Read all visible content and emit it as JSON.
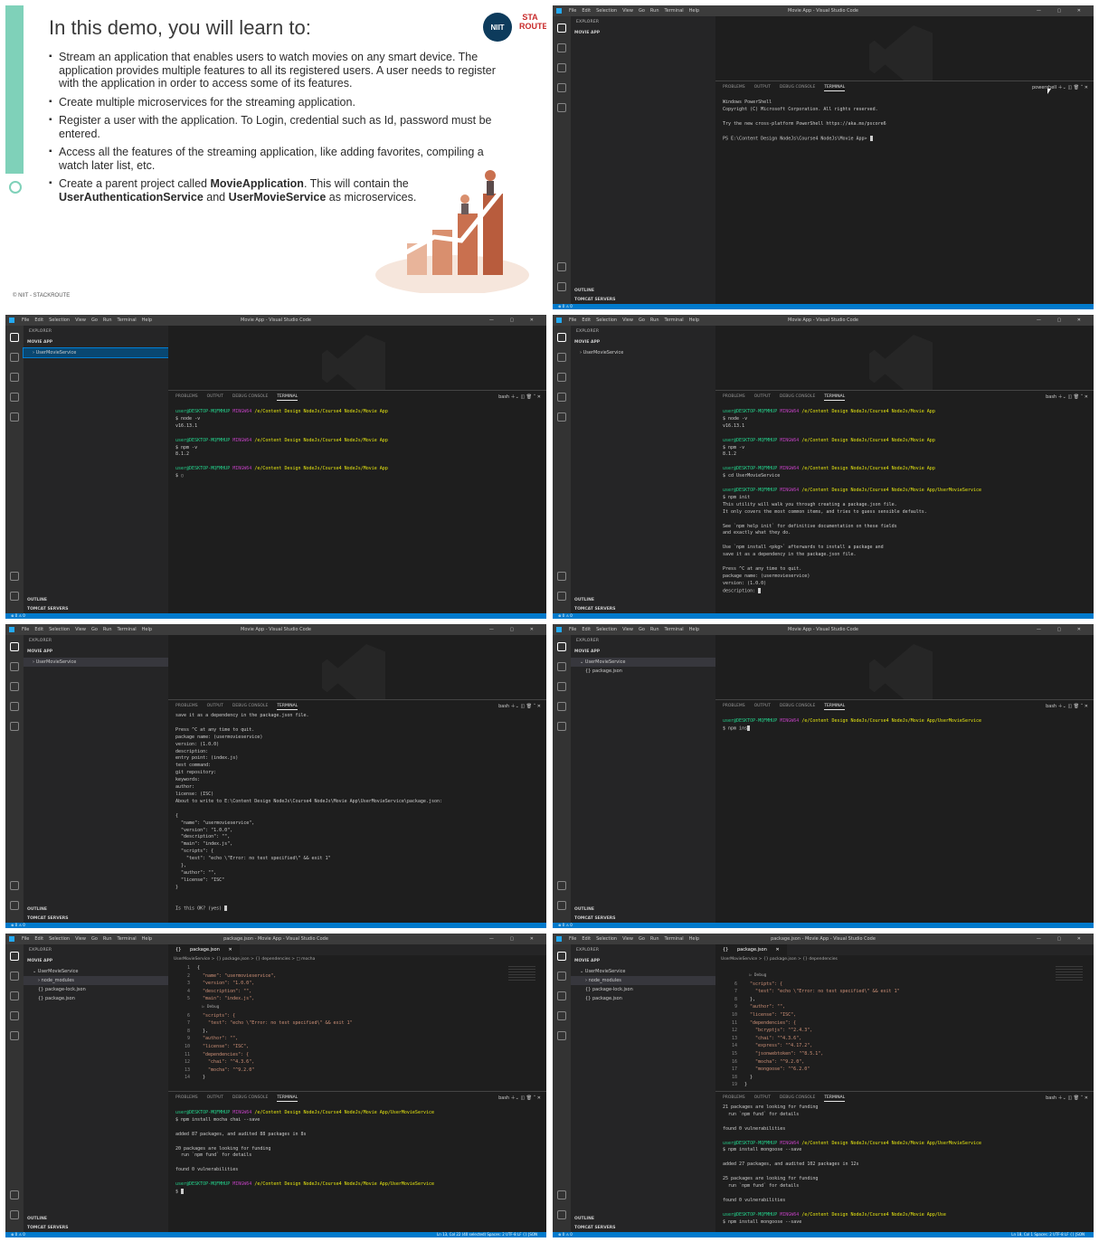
{
  "slide": {
    "title": "In this demo, you will learn to:",
    "logo_round": "NIIT",
    "logo_text": "STA ROUTE",
    "bullets": [
      "Stream an application that enables users to watch movies on any smart device. The application provides multiple features to all its registered users. A user needs to register with the application in order to access some of its features.",
      "Create multiple microservices for the streaming application.",
      "Register a user with the application. To Login, credential such as Id, password must be entered.",
      "Access all the features of the streaming application, like adding favorites, compiling a watch later list, etc."
    ],
    "bullet5_a": "Create a parent project called ",
    "bullet5_b": "MovieApplication",
    "bullet5_c": ". This will contain the ",
    "bullet5_d": "UserAuthenticationService",
    "bullet5_e": " and ",
    "bullet5_f": "UserMovieService",
    "bullet5_g": " as microservices.",
    "footer": "© NIIT - STACKROUTE"
  },
  "vscode": {
    "menu": [
      "File",
      "Edit",
      "Selection",
      "View",
      "Go",
      "Run",
      "Terminal",
      "Help"
    ],
    "title_default": "Movie App - Visual Studio Code",
    "title_pkg": "package.json - Movie App - Visual Studio Code",
    "explorer": "EXPLORER",
    "project": "MOVIE APP",
    "outline": "OUTLINE",
    "tomcat": "TOMCAT SERVERS",
    "tabs": [
      "PROBLEMS",
      "OUTPUT",
      "DEBUG CONSOLE",
      "TERMINAL"
    ],
    "shell_pwsh": "powershell",
    "shell_bash": "bash",
    "folder": "UserMovieService",
    "node_modules": "node_modules",
    "pkg_lock": "package-lock.json",
    "pkg": "package.json",
    "status_left": "⊗ 0 ⚠ 0",
    "status_right_7": "Ln 13, Col 22 (40 selected)   Spaces: 2   UTF-8   LF   {} JSON",
    "status_right_8": "Ln 18, Col 1   Spaces: 2   UTF-8   LF   {} JSON",
    "editor_tab": "package.json",
    "crumb_7": "UserMovieService > {} package.json > {} dependencies > □ mocha",
    "crumb_8": "UserMovieService > {} package.json > {} dependencies"
  },
  "terminals": {
    "t1": "Windows PowerShell\nCopyright (C) Microsoft Corporation. All rights reserved.\n\nTry the new cross-platform PowerShell https://aka.ms/pscore6\n\nPS E:\\Content Design NodeJs\\Course4 NodeJs\\Movie App> ",
    "prompt_user": "user@DESKTOP-MQFMHUP",
    "prompt_env": "MINGW64",
    "path_app": "/e/Content Design NodeJs/Course4 NodeJs/Movie App",
    "path_svc": "/e/Content Design NodeJs/Course4 NodeJs/Movie App/UserMovieService",
    "t2_a": "$ node -v\nv16.13.1\n",
    "t2_b": "$ npm -v\n8.1.2\n",
    "t2_c": "$ ",
    "t3_c": "$ cd UserMovieService\n",
    "t3_d": "$ npm init\nThis utility will walk you through creating a package.json file.\nIt only covers the most common items, and tries to guess sensible defaults.\n\nSee `npm help init` for definitive documentation on these fields\nand exactly what they do.\n\nUse `npm install <pkg>` afterwards to install a package and\nsave it as a dependency in the package.json file.\n\nPress ^C at any time to quit.\npackage name: (usermovieservice)\nversion: (1.0.0)\ndescription: ",
    "t4": "save it as a dependency in the package.json file.\n\nPress ^C at any time to quit.\npackage name: (usermovieservice)\nversion: (1.0.0)\ndescription:\nentry point: (index.js)\ntest command:\ngit repository:\nkeywords:\nauthor:\nlicense: (ISC)\nAbout to write to E:\\Content Design NodeJs\\Course4 NodeJs\\Movie App\\UserMovieService\\package.json:\n\n{\n  \"name\": \"usermovieservice\",\n  \"version\": \"1.0.0\",\n  \"description\": \"\",\n  \"main\": \"index.js\",\n  \"scripts\": {\n    \"test\": \"echo \\\"Error: no test specified\\\" && exit 1\"\n  },\n  \"author\": \"\",\n  \"license\": \"ISC\"\n}\n\n\nIs this OK? (yes) ",
    "t5": "$ npm ins",
    "t6_a": "$ npm install mocha chai --save\n\nadded 87 packages, and audited 88 packages in 8s\n\n20 packages are looking for funding\n  run `npm fund` for details\n\nfound 0 vulnerabilities\n",
    "t6_b": "$ ",
    "t7_a": "21 packages are looking for funding\n  run `npm fund` for details\n\nfound 0 vulnerabilities\n",
    "t7_b": "$ npm install mongoose --save\n\nadded 27 packages, and audited 102 packages in 12s\n\n25 packages are looking for funding\n  run `npm fund` for details\n\nfound 0 vulnerabilities\n",
    "path_cut": "/e/Content Design NodeJs/Course4 NodeJs/Movie App/Use",
    "t7_c": "$ npm install mongoose --save"
  },
  "code7": [
    {
      "n": "1",
      "t": "{"
    },
    {
      "n": "2",
      "t": "  \"name\": \"usermovieservice\","
    },
    {
      "n": "3",
      "t": "  \"version\": \"1.0.0\","
    },
    {
      "n": "4",
      "t": "  \"description\": \"\","
    },
    {
      "n": "5",
      "t": "  \"main\": \"index.js\","
    },
    {
      "n": "",
      "t": "  ▷ Debug"
    },
    {
      "n": "6",
      "t": "  \"scripts\": {"
    },
    {
      "n": "7",
      "t": "    \"test\": \"echo \\\"Error: no test specified\\\" && exit 1\""
    },
    {
      "n": "8",
      "t": "  },"
    },
    {
      "n": "9",
      "t": "  \"author\": \"\","
    },
    {
      "n": "10",
      "t": "  \"license\": \"ISC\","
    },
    {
      "n": "11",
      "t": "  \"dependencies\": {"
    },
    {
      "n": "12",
      "t": "    \"chai\": \"^4.3.6\","
    },
    {
      "n": "13",
      "t": "    \"mocha\": \"^9.2.0\""
    },
    {
      "n": "14",
      "t": "  }"
    }
  ],
  "code8": [
    {
      "n": "",
      "t": "  ▷ Debug"
    },
    {
      "n": "6",
      "t": "  \"scripts\": {"
    },
    {
      "n": "7",
      "t": "    \"test\": \"echo \\\"Error: no test specified\\\" && exit 1\""
    },
    {
      "n": "8",
      "t": "  },"
    },
    {
      "n": "9",
      "t": "  \"author\": \"\","
    },
    {
      "n": "10",
      "t": "  \"license\": \"ISC\","
    },
    {
      "n": "11",
      "t": "  \"dependencies\": {"
    },
    {
      "n": "12",
      "t": "    \"bcryptjs\": \"^2.4.3\","
    },
    {
      "n": "13",
      "t": "    \"chai\": \"^4.3.6\","
    },
    {
      "n": "14",
      "t": "    \"express\": \"^4.17.2\","
    },
    {
      "n": "15",
      "t": "    \"jsonwebtoken\": \"^8.5.1\","
    },
    {
      "n": "16",
      "t": "    \"mocha\": \"^9.2.0\","
    },
    {
      "n": "17",
      "t": "    \"mongoose\": \"^6.2.0\""
    },
    {
      "n": "18",
      "t": "  }"
    },
    {
      "n": "19",
      "t": "}"
    }
  ]
}
